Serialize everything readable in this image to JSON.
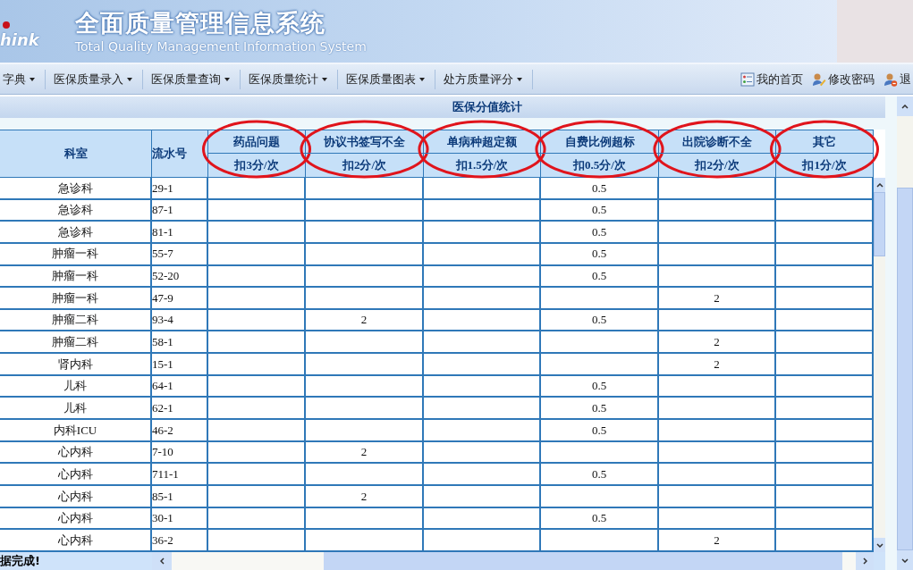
{
  "header": {
    "logo": "hink",
    "title": "全面质量管理信息系统",
    "subtitle": "Total Quality Management Information System"
  },
  "nav": {
    "menus": [
      {
        "label": "字典"
      },
      {
        "label": "医保质量录入"
      },
      {
        "label": "医保质量查询"
      },
      {
        "label": "医保质量统计"
      },
      {
        "label": "医保质量图表"
      },
      {
        "label": "处方质量评分"
      }
    ],
    "links": [
      {
        "kind": "home",
        "label": "我的首页"
      },
      {
        "kind": "password",
        "label": "修改密码"
      },
      {
        "kind": "logout",
        "label": "退"
      }
    ]
  },
  "panel_title": "医保分值统计",
  "table": {
    "columns": [
      {
        "label": "科室"
      },
      {
        "label": "流水号"
      }
    ],
    "deduct_columns": [
      {
        "label": "药品问题",
        "rule": "扣3分/次",
        "circled": true
      },
      {
        "label": "协议书签写不全",
        "rule": "扣2分/次",
        "circled": true
      },
      {
        "label": "单病种超定额",
        "rule": "扣1.5分/次",
        "circled": true
      },
      {
        "label": "自费比例超标",
        "rule": "扣0.5分/次",
        "circled": true
      },
      {
        "label": "出院诊断不全",
        "rule": "扣2分/次",
        "circled": true
      },
      {
        "label": "其它",
        "rule": "扣1分/次",
        "circled": true
      }
    ],
    "rows": [
      [
        "急诊科",
        "29-1",
        "",
        "",
        "",
        "0.5",
        "",
        ""
      ],
      [
        "急诊科",
        "87-1",
        "",
        "",
        "",
        "0.5",
        "",
        ""
      ],
      [
        "急诊科",
        "81-1",
        "",
        "",
        "",
        "0.5",
        "",
        ""
      ],
      [
        "肿瘤一科",
        "55-7",
        "",
        "",
        "",
        "0.5",
        "",
        ""
      ],
      [
        "肿瘤一科",
        "52-20",
        "",
        "",
        "",
        "0.5",
        "",
        ""
      ],
      [
        "肿瘤一科",
        "47-9",
        "",
        "",
        "",
        "",
        "2",
        ""
      ],
      [
        "肿瘤二科",
        "93-4",
        "",
        "2",
        "",
        "0.5",
        "",
        ""
      ],
      [
        "肿瘤二科",
        "58-1",
        "",
        "",
        "",
        "",
        "2",
        ""
      ],
      [
        "肾内科",
        "15-1",
        "",
        "",
        "",
        "",
        "2",
        ""
      ],
      [
        "儿科",
        "64-1",
        "",
        "",
        "",
        "0.5",
        "",
        ""
      ],
      [
        "儿科",
        "62-1",
        "",
        "",
        "",
        "0.5",
        "",
        ""
      ],
      [
        "内科ICU",
        "46-2",
        "",
        "",
        "",
        "0.5",
        "",
        ""
      ],
      [
        "心内科",
        "7-10",
        "",
        "2",
        "",
        "",
        "",
        ""
      ],
      [
        "心内科",
        "711-1",
        "",
        "",
        "",
        "0.5",
        "",
        ""
      ],
      [
        "心内科",
        "85-1",
        "",
        "2",
        "",
        "",
        "",
        ""
      ],
      [
        "心内科",
        "30-1",
        "",
        "",
        "",
        "0.5",
        "",
        ""
      ],
      [
        "心内科",
        "36-2",
        "",
        "",
        "",
        "",
        "2",
        ""
      ]
    ]
  },
  "status_bar": "据完成!"
}
